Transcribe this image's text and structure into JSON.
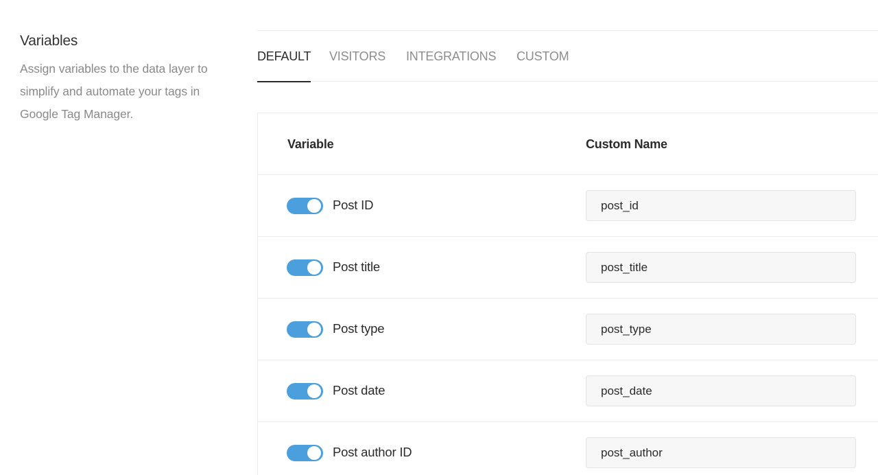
{
  "intro": {
    "title": "Variables",
    "description": "Assign variables to the data layer to simplify and automate your tags in Google Tag Manager."
  },
  "tabs": [
    {
      "label": "DEFAULT",
      "active": true
    },
    {
      "label": "VISITORS",
      "active": false
    },
    {
      "label": "INTEGRATIONS",
      "active": false
    },
    {
      "label": "CUSTOM",
      "active": false
    }
  ],
  "table": {
    "headers": {
      "variable": "Variable",
      "custom_name": "Custom Name"
    },
    "rows": [
      {
        "label": "Post ID",
        "enabled": true,
        "custom_name": "post_id"
      },
      {
        "label": "Post title",
        "enabled": true,
        "custom_name": "post_title"
      },
      {
        "label": "Post type",
        "enabled": true,
        "custom_name": "post_type"
      },
      {
        "label": "Post date",
        "enabled": true,
        "custom_name": "post_date"
      },
      {
        "label": "Post author ID",
        "enabled": true,
        "custom_name": "post_author"
      }
    ]
  },
  "colors": {
    "toggle_on": "#4a9fdc",
    "active_tab": "#2b2b2b",
    "inactive_tab": "#8d8d8d",
    "description_text": "#8a8a8a"
  }
}
